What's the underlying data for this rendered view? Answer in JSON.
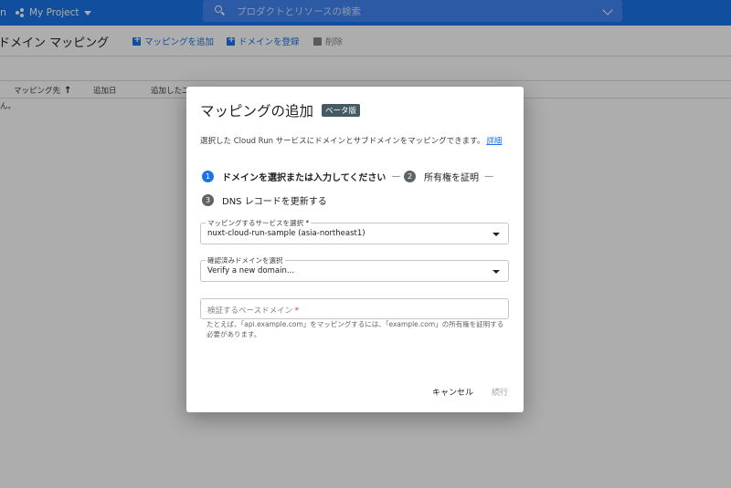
{
  "topbar": {
    "left_fragment": "n",
    "project_name": "My Project",
    "search_placeholder": "プロダクトとリソースの検索"
  },
  "page": {
    "title": "ドメイン マッピング",
    "actions": {
      "add_mapping": "マッピングを追加",
      "register_domain": "ドメインを登録",
      "delete": "削除"
    },
    "table": {
      "columns": [
        "マッピング先",
        "追加日",
        "追加したユ"
      ],
      "empty_text": "ん。"
    }
  },
  "dialog": {
    "title": "マッピングの追加",
    "beta_badge": "ベータ版",
    "description": "選択した Cloud Run サービスにドメインとサブドメインをマッピングできます。",
    "details_link": "詳細",
    "steps": [
      {
        "number": "1",
        "label": "ドメインを選択または入力してください"
      },
      {
        "number": "2",
        "label": "所有権を証明"
      },
      {
        "number": "3",
        "label": "DNS レコードを更新する"
      }
    ],
    "step_separator": "—",
    "service_select": {
      "label": "マッピングするサービスを選択",
      "value": "nuxt-cloud-run-sample (asia-northeast1)"
    },
    "domain_select": {
      "label": "確認済みドメインを選択",
      "value": "Verify a new domain..."
    },
    "base_domain_input": {
      "placeholder": "検証するベースドメイン",
      "required_mark": "*",
      "hint": "たとえば、「api.example.com」をマッピングするには、「example.com」の所有権を証明する必要があります。"
    },
    "buttons": {
      "cancel": "キャンセル",
      "continue": "続行"
    }
  },
  "colors": {
    "accent": "#1a73e8",
    "search_bg": "#4285f4",
    "beta_bg": "#455a64",
    "required": "#d93025"
  }
}
